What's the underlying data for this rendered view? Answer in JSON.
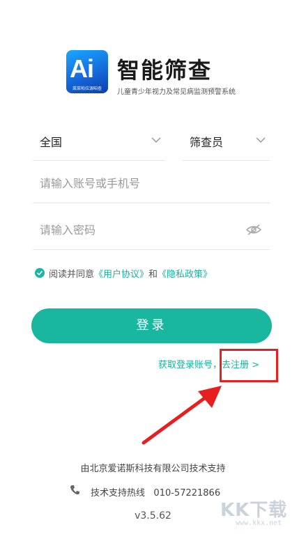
{
  "app": {
    "name": "智能筛查",
    "subtitle": "儿童青少年视力及常见病监测预警系统",
    "logo_mark": "Ai",
    "logo_tagline": "菜菜帕拉源咱查"
  },
  "form": {
    "region_value": "全国",
    "role_value": "筛查员",
    "account_placeholder": "请输入账号或手机号",
    "password_placeholder": "请输入密码"
  },
  "agreement": {
    "prefix": "阅读并同意",
    "user_agreement": "《用户协议》",
    "and": "和",
    "privacy_policy": "《隐私政策》"
  },
  "login_button": "登录",
  "register": {
    "get_account": "获取登录账号，",
    "go_register": "去注册 >"
  },
  "footer": {
    "company": "由北京爱诺斯科技有限公司技术支持",
    "hotline_label": "技术支持热线",
    "hotline_number": "010-57221866",
    "version": "v3.5.62"
  },
  "watermark": {
    "main": "KK下载",
    "url": "www.kkx.net"
  },
  "colors": {
    "accent": "#19b7a0",
    "annotation": "#e62020"
  }
}
